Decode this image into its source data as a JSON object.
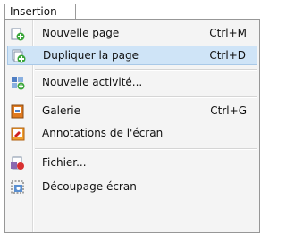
{
  "menubar": {
    "tab_label": "Insertion"
  },
  "menu": {
    "items": [
      {
        "label": "Nouvelle page",
        "shortcut": "Ctrl+M",
        "icon": "new-page-icon"
      },
      {
        "label": "Dupliquer la page",
        "shortcut": "Ctrl+D",
        "icon": "duplicate-page-icon",
        "highlighted": true
      },
      {
        "label": "Nouvelle activité...",
        "shortcut": "",
        "icon": "new-activity-icon"
      },
      {
        "label": "Galerie",
        "shortcut": "Ctrl+G",
        "icon": "gallery-icon"
      },
      {
        "label": "Annotations de l'écran",
        "shortcut": "",
        "icon": "screen-annotation-icon"
      },
      {
        "label": "Fichier...",
        "shortcut": "",
        "icon": "file-icon"
      },
      {
        "label": "Découpage écran",
        "shortcut": "",
        "icon": "screen-capture-icon"
      }
    ]
  }
}
